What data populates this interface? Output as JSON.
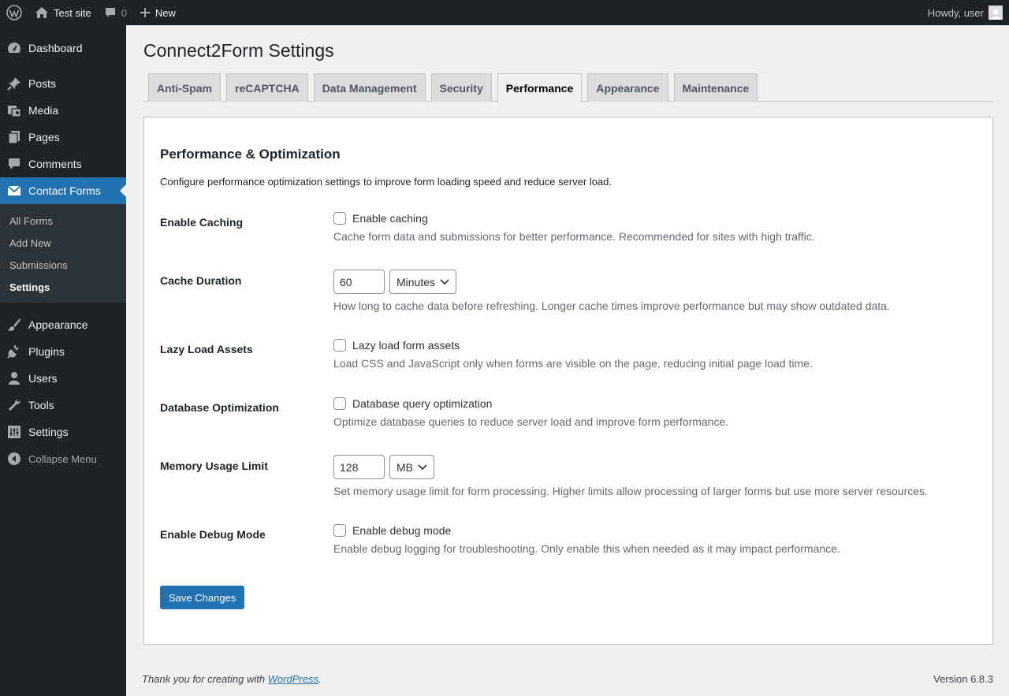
{
  "adminbar": {
    "site_name": "Test site",
    "comments_count": "0",
    "new_label": "New",
    "howdy": "Howdy, user"
  },
  "sidebar": {
    "items": [
      {
        "label": "Dashboard",
        "icon": "dashboard-icon"
      },
      {
        "label": "Posts",
        "icon": "pin-icon"
      },
      {
        "label": "Media",
        "icon": "media-icon"
      },
      {
        "label": "Pages",
        "icon": "pages-icon"
      },
      {
        "label": "Comments",
        "icon": "comment-icon"
      },
      {
        "label": "Contact Forms",
        "icon": "envelope-icon"
      },
      {
        "label": "Appearance",
        "icon": "brush-icon"
      },
      {
        "label": "Plugins",
        "icon": "plug-icon"
      },
      {
        "label": "Users",
        "icon": "user-icon"
      },
      {
        "label": "Tools",
        "icon": "wrench-icon"
      },
      {
        "label": "Settings",
        "icon": "settings-icon"
      }
    ],
    "submenu": [
      "All Forms",
      "Add New",
      "Submissions",
      "Settings"
    ],
    "collapse": "Collapse Menu"
  },
  "page": {
    "title": "Connect2Form Settings",
    "tabs": [
      "Anti-Spam",
      "reCAPTCHA",
      "Data Management",
      "Security",
      "Performance",
      "Appearance",
      "Maintenance"
    ],
    "active_tab": "Performance"
  },
  "section": {
    "title": "Performance & Optimization",
    "description": "Configure performance optimization settings to improve form loading speed and reduce server load."
  },
  "settings": {
    "caching": {
      "label": "Enable Caching",
      "checkbox": "Enable caching",
      "checked": false,
      "desc": "Cache form data and submissions for better performance. Recommended for sites with high traffic."
    },
    "cache_duration": {
      "label": "Cache Duration",
      "value": "60",
      "unit": "Minutes",
      "desc": "How long to cache data before refreshing. Longer cache times improve performance but may show outdated data."
    },
    "lazy_load": {
      "label": "Lazy Load Assets",
      "checkbox": "Lazy load form assets",
      "checked": false,
      "desc": "Load CSS and JavaScript only when forms are visible on the page, reducing initial page load time."
    },
    "db_opt": {
      "label": "Database Optimization",
      "checkbox": "Database query optimization",
      "checked": false,
      "desc": "Optimize database queries to reduce server load and improve form performance."
    },
    "memory": {
      "label": "Memory Usage Limit",
      "value": "128",
      "unit": "MB",
      "desc": "Set memory usage limit for form processing. Higher limits allow processing of larger forms but use more server resources."
    },
    "debug": {
      "label": "Enable Debug Mode",
      "checkbox": "Enable debug mode",
      "checked": false,
      "desc": "Enable debug logging for troubleshooting. Only enable this when needed as it may impact performance."
    }
  },
  "save_label": "Save Changes",
  "footer": {
    "thanks_prefix": "Thank you for creating with ",
    "thanks_link": "WordPress",
    "thanks_suffix": ".",
    "version": "Version 6.8.3"
  },
  "colors": {
    "accent": "#2271b1",
    "adminbar_bg": "#1d2327",
    "page_bg": "#f0f0f1"
  }
}
